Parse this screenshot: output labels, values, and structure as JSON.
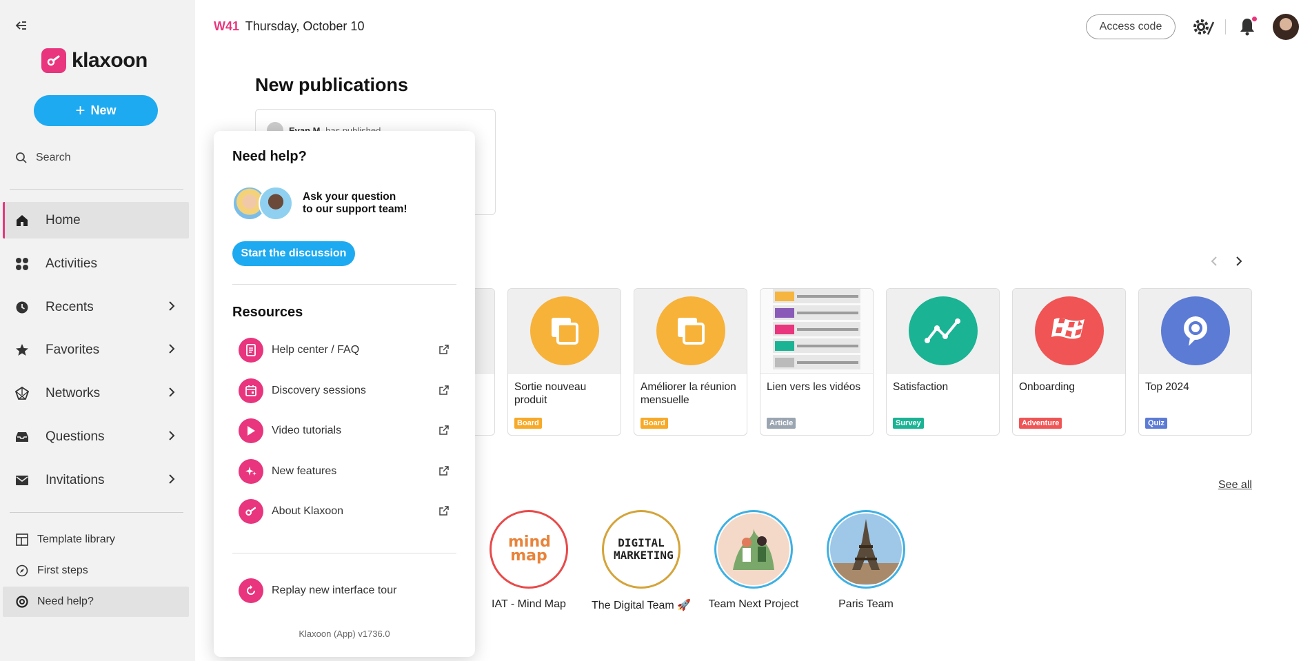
{
  "header": {
    "week": "W41",
    "date": "Thursday, October 10",
    "access_code": "Access code"
  },
  "sidebar": {
    "logo": "klaxoon",
    "new_label": "New",
    "search_label": "Search",
    "items": [
      {
        "label": "Home",
        "icon": "home-icon"
      },
      {
        "label": "Activities",
        "icon": "grid-icon"
      },
      {
        "label": "Recents",
        "icon": "clock-icon"
      },
      {
        "label": "Favorites",
        "icon": "star-icon"
      },
      {
        "label": "Networks",
        "icon": "network-icon"
      },
      {
        "label": "Questions",
        "icon": "inbox-icon"
      },
      {
        "label": "Invitations",
        "icon": "mail-icon"
      }
    ],
    "bottom": [
      {
        "label": "Template library",
        "icon": "template-icon"
      },
      {
        "label": "First steps",
        "icon": "compass-icon"
      },
      {
        "label": "Need help?",
        "icon": "help-icon"
      }
    ]
  },
  "main": {
    "publications_title": "New publications",
    "publication": {
      "author": "Evan M.",
      "action": "has published"
    },
    "activities": [
      {
        "title": "Sortie nouveau produit",
        "badge": "Board",
        "color": "#f7a928"
      },
      {
        "title": "Améliorer la réunion mensuelle",
        "badge": "Board",
        "color": "#f7a928"
      },
      {
        "title": "Lien vers les vidéos",
        "badge": "Article",
        "color": "#9aa5b1"
      },
      {
        "title": "Satisfaction",
        "badge": "Survey",
        "color": "#1ab394"
      },
      {
        "title": "Onboarding",
        "badge": "Adventure",
        "color": "#f05454"
      },
      {
        "title": "Top 2024",
        "badge": "Quiz",
        "color": "#5b7bd5"
      }
    ],
    "see_all": "See all",
    "teams": [
      {
        "name": "IAT - Mind Map",
        "ring": "#e84a4a",
        "logo": "mind map"
      },
      {
        "name": "The Digital Team 🚀",
        "ring": "#d4a43a",
        "logo": "DIGITAL MARKETING"
      },
      {
        "name": "Team Next Project",
        "ring": "#3fb0e3"
      },
      {
        "name": "Paris Team",
        "ring": "#3fb0e3"
      }
    ]
  },
  "help": {
    "title": "Need help?",
    "support_line1": "Ask your question",
    "support_line2": "to our support team!",
    "start_button": "Start the discussion",
    "resources_title": "Resources",
    "resources": [
      {
        "label": "Help center / FAQ",
        "icon": "document-icon"
      },
      {
        "label": "Discovery sessions",
        "icon": "calendar-icon"
      },
      {
        "label": "Video tutorials",
        "icon": "play-icon"
      },
      {
        "label": "New features",
        "icon": "sparkle-icon"
      },
      {
        "label": "About Klaxoon",
        "icon": "klaxoon-icon"
      }
    ],
    "replay": "Replay new interface tour",
    "version": "Klaxoon (App) v1736.0"
  }
}
